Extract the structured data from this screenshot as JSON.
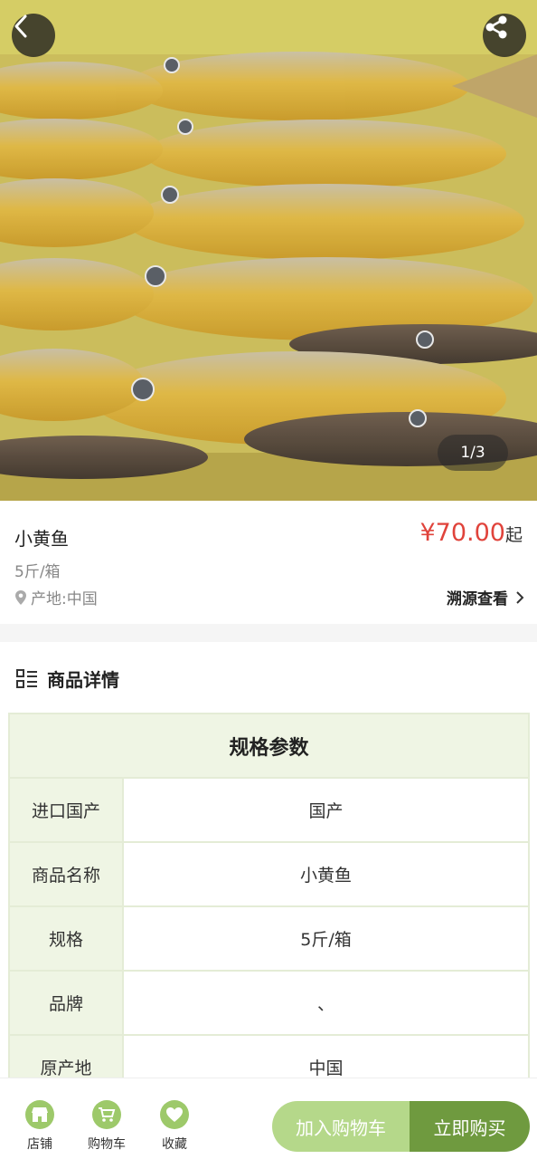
{
  "hero": {
    "pager": "1/3",
    "back_icon": "chevron-left-icon",
    "share_icon": "share-icon"
  },
  "product": {
    "name": "小黄鱼",
    "price": "¥70.00",
    "price_suffix": "起",
    "spec": "5斤/箱",
    "origin": "产地:中国",
    "trace": "溯源查看"
  },
  "detail": {
    "title": "商品详情",
    "table_title": "规格参数",
    "rows": [
      {
        "key": "进口国产",
        "value": "国产"
      },
      {
        "key": "商品名称",
        "value": "小黄鱼"
      },
      {
        "key": "规格",
        "value": "5斤/箱"
      },
      {
        "key": "品牌",
        "value": "、"
      },
      {
        "key": "原产地",
        "value": "中国"
      }
    ]
  },
  "bottom": {
    "tabs": [
      {
        "label": "店铺",
        "icon": "store-icon"
      },
      {
        "label": "购物车",
        "icon": "cart-icon"
      },
      {
        "label": "收藏",
        "icon": "heart-icon"
      }
    ],
    "add_cart": "加入购物车",
    "buy_now": "立即购买"
  },
  "colors": {
    "price": "#e0433b",
    "accent_light": "#b5d88a",
    "accent_dark": "#6f9a3f",
    "table_header": "#eff5e4"
  }
}
